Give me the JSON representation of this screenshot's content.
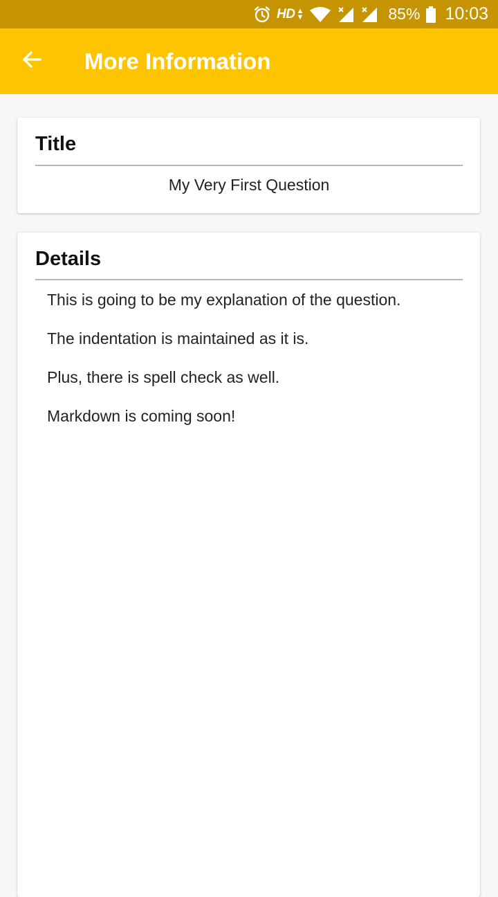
{
  "status_bar": {
    "alarm_icon": "alarm-clock-icon",
    "hd_label": "HD",
    "data_arrows": "▲▼",
    "wifi_icon": "wifi-icon",
    "signal_icon_1": "cell-signal-icon",
    "signal_icon_2": "cell-signal-icon",
    "battery_percent": "85%",
    "battery_icon": "battery-icon",
    "time": "10:03"
  },
  "app_bar": {
    "back_icon": "arrow-back-icon",
    "title": "More Information"
  },
  "title_card": {
    "heading": "Title",
    "value": "My Very First Question"
  },
  "details_card": {
    "heading": "Details",
    "lines": [
      "This is going to be my explanation of the question.",
      "The indentation is maintained as it is.",
      "Plus, there is spell check as well.",
      "Markdown is coming soon!"
    ]
  },
  "colors": {
    "status_bar_bg": "#c69400",
    "app_bar_bg": "#fec400",
    "page_bg": "#f7f7f7",
    "card_bg": "#ffffff",
    "divider": "#b5b5b5"
  }
}
